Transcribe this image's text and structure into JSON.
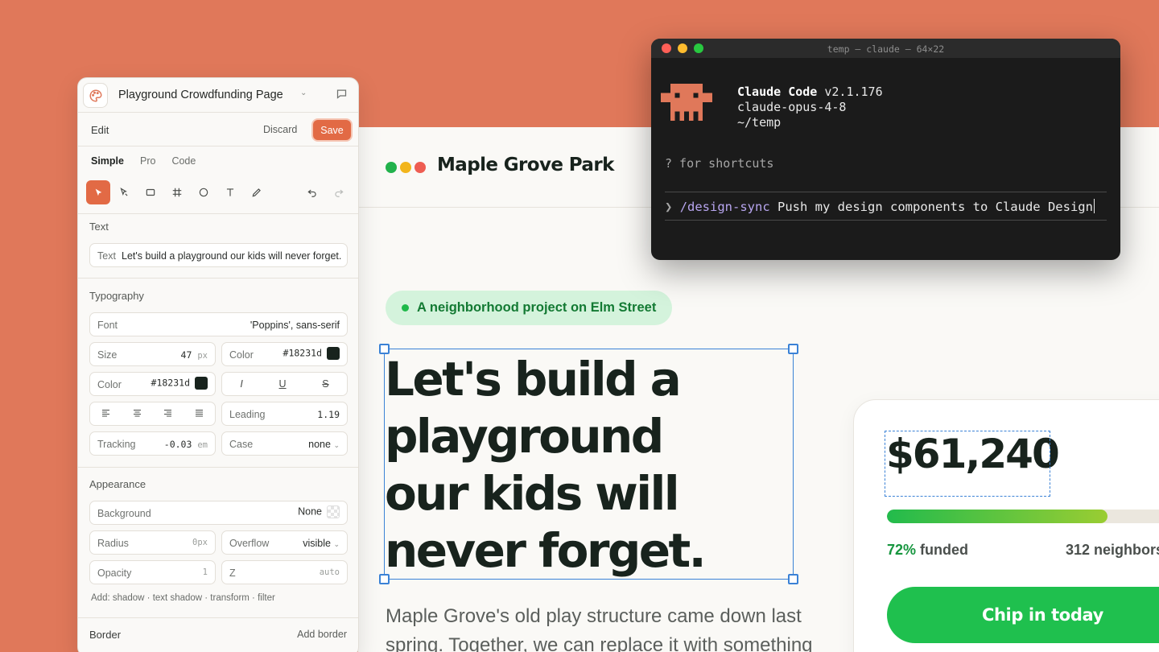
{
  "editor": {
    "doc_title": "Playground Crowdfunding Page",
    "edit_label": "Edit",
    "discard_label": "Discard",
    "save_label": "Save",
    "tabs": [
      "Simple",
      "Pro",
      "Code"
    ],
    "active_tab": "Simple",
    "text_section": {
      "label": "Text",
      "field_label": "Text",
      "value": "Let's build a playground our kids will never forget."
    },
    "typography": {
      "label": "Typography",
      "font_label": "Font",
      "font_value": "'Poppins', sans-serif",
      "size_label": "Size",
      "size_value": "47",
      "size_unit": "px",
      "color_label": "Color",
      "color_value": "#18231d",
      "style_italic": "I",
      "style_underline": "U",
      "style_strike": "S",
      "leading_label": "Leading",
      "leading_value": "1.19",
      "tracking_label": "Tracking",
      "tracking_value": "-0.03",
      "tracking_unit": "em",
      "case_label": "Case",
      "case_value": "none"
    },
    "appearance": {
      "label": "Appearance",
      "background_label": "Background",
      "background_value": "None",
      "radius_label": "Radius",
      "radius_value": "0px",
      "overflow_label": "Overflow",
      "overflow_value": "visible",
      "opacity_label": "Opacity",
      "opacity_value": "1",
      "z_label": "Z",
      "z_value": "auto",
      "add_line": "Add: shadow · text shadow · transform · filter"
    },
    "border": {
      "label": "Border",
      "add_label": "Add border"
    },
    "accent_color": "#e26a45"
  },
  "site": {
    "brand": "Maple Grove Park",
    "logo_colors": [
      "#22b24c",
      "#f2b51c",
      "#ee5d52"
    ],
    "pill": "A neighborhood project on Elm Street",
    "headline_lines": [
      "Let's build a",
      "playground",
      "our kids will",
      "never forget."
    ],
    "body_text": "Maple Grove's old play structure came down last spring. Together, we can replace it with something",
    "amount": "$61,240",
    "funded_fraction": 0.72,
    "funded_pct": "72%",
    "funded_word": "funded",
    "neighbors": "312 neighbors",
    "cta": "Chip in today"
  },
  "terminal": {
    "title": "temp — claude — 64×22",
    "app_name": "Claude Code",
    "version": "v2.1.176",
    "model": "claude-opus-4-8",
    "cwd": "~/temp",
    "hint": "? for shortcuts",
    "caret": "❯",
    "command": "/design-sync",
    "args": "Push my design components to Claude Design"
  }
}
